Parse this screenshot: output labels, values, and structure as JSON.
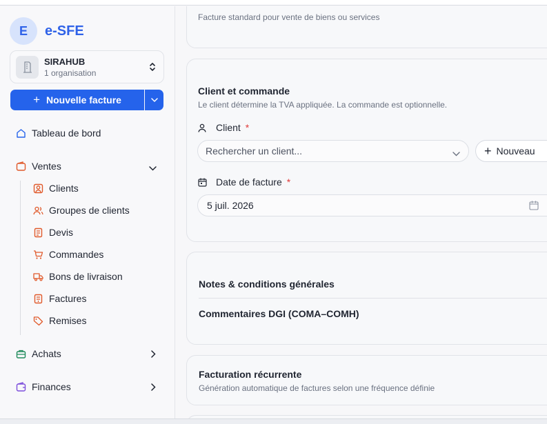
{
  "brand": {
    "initial": "E",
    "name": "e-SFE"
  },
  "organization": {
    "name": "SIRAHUB",
    "subtitle": "1 organisation"
  },
  "new_invoice": {
    "label": "Nouvelle facture"
  },
  "nav": {
    "dashboard": "Tableau de bord",
    "sales": "Ventes",
    "sales_items": [
      "Clients",
      "Groupes de clients",
      "Devis",
      "Commandes",
      "Bons de livraison",
      "Factures",
      "Remises"
    ],
    "purchases": "Achats",
    "finances": "Finances"
  },
  "invoice_type_card": {
    "description": "Facture standard pour vente de biens ou services"
  },
  "client_card": {
    "title": "Client et commande",
    "subtitle": "Le client détermine la TVA appliquée. La commande est optionnelle.",
    "client_label": "Client",
    "client_required": "*",
    "client_placeholder": "Rechercher un client...",
    "new_button": "Nouveau",
    "date_label": "Date de facture",
    "date_required": "*",
    "date_value": "5 juil. 2026"
  },
  "notes_card": {
    "title": "Notes & conditions générales",
    "dgi_title": "Commentaires DGI (COMA–COMH)"
  },
  "recurring_card": {
    "title": "Facturation récurrente",
    "subtitle": "Génération automatique de factures selon une fréquence définie"
  },
  "colors": {
    "accent": "#2563eb",
    "brand": "#2f62e8",
    "icon_orange": "#e0592a",
    "required": "#e03a3a"
  }
}
